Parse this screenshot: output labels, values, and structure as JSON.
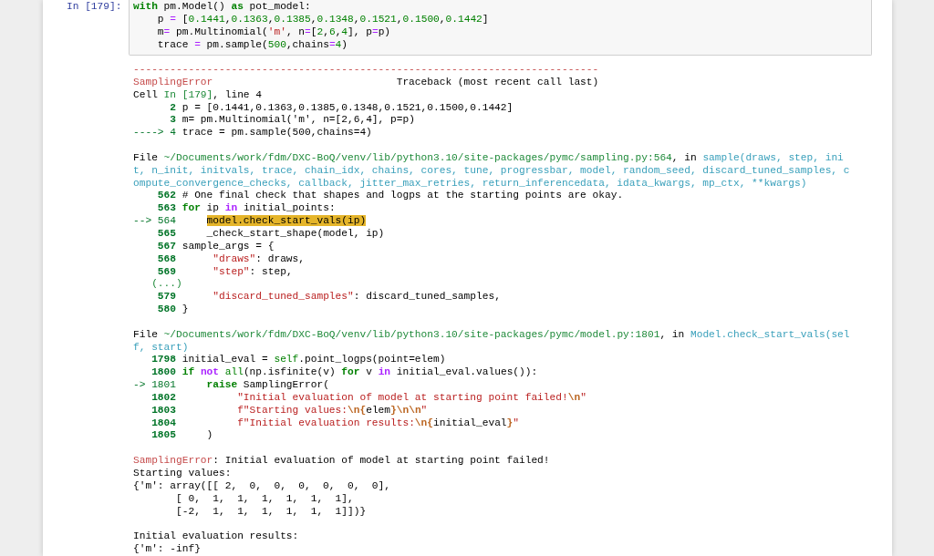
{
  "cell": {
    "prompt": "In [179]:",
    "code": [
      [
        {
          "kind": "kw",
          "text": "with"
        },
        {
          "kind": "plain",
          "text": " pm.Model() "
        },
        {
          "kind": "kw",
          "text": "as"
        },
        {
          "kind": "plain",
          "text": " pot_model:"
        }
      ],
      [
        {
          "kind": "plain",
          "text": "    p "
        },
        {
          "kind": "op",
          "text": "="
        },
        {
          "kind": "plain",
          "text": " ["
        },
        {
          "kind": "num",
          "text": "0.1441"
        },
        {
          "kind": "plain",
          "text": ","
        },
        {
          "kind": "num",
          "text": "0.1363"
        },
        {
          "kind": "plain",
          "text": ","
        },
        {
          "kind": "num",
          "text": "0.1385"
        },
        {
          "kind": "plain",
          "text": ","
        },
        {
          "kind": "num",
          "text": "0.1348"
        },
        {
          "kind": "plain",
          "text": ","
        },
        {
          "kind": "num",
          "text": "0.1521"
        },
        {
          "kind": "plain",
          "text": ","
        },
        {
          "kind": "num",
          "text": "0.1500"
        },
        {
          "kind": "plain",
          "text": ","
        },
        {
          "kind": "num",
          "text": "0.1442"
        },
        {
          "kind": "plain",
          "text": "]"
        }
      ],
      [
        {
          "kind": "plain",
          "text": "    m"
        },
        {
          "kind": "op",
          "text": "="
        },
        {
          "kind": "plain",
          "text": " pm.Multinomial("
        },
        {
          "kind": "str",
          "text": "'m'"
        },
        {
          "kind": "plain",
          "text": ", n"
        },
        {
          "kind": "op",
          "text": "="
        },
        {
          "kind": "plain",
          "text": "["
        },
        {
          "kind": "num",
          "text": "2"
        },
        {
          "kind": "plain",
          "text": ","
        },
        {
          "kind": "num",
          "text": "6"
        },
        {
          "kind": "plain",
          "text": ","
        },
        {
          "kind": "num",
          "text": "4"
        },
        {
          "kind": "plain",
          "text": "], p"
        },
        {
          "kind": "op",
          "text": "="
        },
        {
          "kind": "plain",
          "text": "p)"
        }
      ],
      [
        {
          "kind": "plain",
          "text": "    trace "
        },
        {
          "kind": "op",
          "text": "="
        },
        {
          "kind": "plain",
          "text": " pm.sample("
        },
        {
          "kind": "num",
          "text": "500"
        },
        {
          "kind": "plain",
          "text": ",chains"
        },
        {
          "kind": "op",
          "text": "="
        },
        {
          "kind": "num",
          "text": "4"
        },
        {
          "kind": "plain",
          "text": ")"
        }
      ]
    ],
    "output": [
      {
        "lines": [
          [
            {
              "kind": "rule",
              "text": "----------------------------------------------------------------------------"
            }
          ],
          [
            {
              "kind": "err",
              "text": "SamplingError"
            },
            {
              "kind": "plain",
              "text": "                              Traceback (most recent call last)"
            }
          ],
          [
            {
              "kind": "plain",
              "text": "Cell "
            },
            {
              "kind": "path",
              "text": "In [179]"
            },
            {
              "kind": "plain",
              "text": ", line 4"
            }
          ],
          [
            {
              "kind": "lno",
              "text": "      2"
            },
            {
              "kind": "plain",
              "text": " p = [0.1441,0.1363,0.1385,0.1348,0.1521,0.1500,0.1442]"
            }
          ],
          [
            {
              "kind": "lno",
              "text": "      3"
            },
            {
              "kind": "plain",
              "text": " m= pm.Multinomial('m', n=[2,6,4], p=p)"
            }
          ],
          [
            {
              "kind": "arrow",
              "text": "----> 4"
            },
            {
              "kind": "plain",
              "text": " trace = pm.sample(500,chains=4)"
            }
          ]
        ]
      },
      {
        "lines": [
          [
            {
              "kind": "plain",
              "text": "File "
            },
            {
              "kind": "path",
              "text": "~/Documents/work/fdm/DXC-BoQ/venv/lib/python3.10/site-packages/pymc/sampling.py:564"
            },
            {
              "kind": "plain",
              "text": ", in "
            },
            {
              "kind": "func",
              "text": "sample(draws, step, init, n_init, initvals, trace, chain_idx, chains, cores, tune, progressbar, model, random_seed, discard_tuned_samples, compute_convergence_checks, callback, jitter_max_retries, return_inferencedata, idata_kwargs, mp_ctx, **kwargs)"
            }
          ],
          [
            {
              "kind": "lno",
              "text": "    562"
            },
            {
              "kind": "plain",
              "text": " # One final check that shapes and logps at the starting points are okay."
            }
          ],
          [
            {
              "kind": "lno",
              "text": "    563 "
            },
            {
              "kind": "kw",
              "text": "for"
            },
            {
              "kind": "plain",
              "text": " ip "
            },
            {
              "kind": "kw2",
              "text": "in"
            },
            {
              "kind": "plain",
              "text": " initial_points:"
            }
          ],
          [
            {
              "kind": "arrow",
              "text": "--> 564     "
            },
            {
              "kind": "hl",
              "text": "model.check_start_vals(ip)"
            }
          ],
          [
            {
              "kind": "lno",
              "text": "    565"
            },
            {
              "kind": "plain",
              "text": "     _check_start_shape(model, ip)"
            }
          ],
          [
            {
              "kind": "lno",
              "text": "    567"
            },
            {
              "kind": "plain",
              "text": " sample_args = {"
            }
          ],
          [
            {
              "kind": "lno",
              "text": "    568      "
            },
            {
              "kind": "str",
              "text": "\"draws\""
            },
            {
              "kind": "plain",
              "text": ": draws,"
            }
          ],
          [
            {
              "kind": "lno",
              "text": "    569      "
            },
            {
              "kind": "str",
              "text": "\"step\""
            },
            {
              "kind": "plain",
              "text": ": step,"
            }
          ],
          [
            {
              "kind": "path",
              "text": "   (...)"
            }
          ],
          [
            {
              "kind": "lno",
              "text": "    579      "
            },
            {
              "kind": "str",
              "text": "\"discard_tuned_samples\""
            },
            {
              "kind": "plain",
              "text": ": discard_tuned_samples,"
            }
          ],
          [
            {
              "kind": "lno",
              "text": "    580"
            },
            {
              "kind": "plain",
              "text": " }"
            }
          ]
        ]
      },
      {
        "lines": [
          [
            {
              "kind": "plain",
              "text": "File "
            },
            {
              "kind": "path",
              "text": "~/Documents/work/fdm/DXC-BoQ/venv/lib/python3.10/site-packages/pymc/model.py:1801"
            },
            {
              "kind": "plain",
              "text": ", in "
            },
            {
              "kind": "func",
              "text": "Model.check_start_vals(self, start)"
            }
          ],
          [
            {
              "kind": "lno",
              "text": "   1798"
            },
            {
              "kind": "plain",
              "text": " initial_eval = "
            },
            {
              "kind": "builtin",
              "text": "self"
            },
            {
              "kind": "plain",
              "text": ".point_logps(point=elem)"
            }
          ],
          [
            {
              "kind": "lno",
              "text": "   1800 "
            },
            {
              "kind": "kw",
              "text": "if"
            },
            {
              "kind": "kw2",
              "text": " not "
            },
            {
              "kind": "builtin",
              "text": "all"
            },
            {
              "kind": "plain",
              "text": "(np.isfinite(v) "
            },
            {
              "kind": "kw",
              "text": "for"
            },
            {
              "kind": "plain",
              "text": " v "
            },
            {
              "kind": "kw2",
              "text": "in"
            },
            {
              "kind": "plain",
              "text": " initial_eval.values()):"
            }
          ],
          [
            {
              "kind": "arrow",
              "text": "-> 1801     "
            },
            {
              "kind": "kw",
              "text": "raise"
            },
            {
              "kind": "plain",
              "text": " SamplingError("
            }
          ],
          [
            {
              "kind": "lno",
              "text": "   1802          "
            },
            {
              "kind": "str",
              "text": "\"Initial evaluation of model at starting point failed!"
            },
            {
              "kind": "esc",
              "text": "\\n"
            },
            {
              "kind": "str",
              "text": "\""
            }
          ],
          [
            {
              "kind": "lno",
              "text": "   1803          "
            },
            {
              "kind": "str",
              "text": "f\"Starting values:"
            },
            {
              "kind": "esc",
              "text": "\\n"
            },
            {
              "kind": "esc",
              "text": "{"
            },
            {
              "kind": "plain",
              "text": "elem"
            },
            {
              "kind": "esc",
              "text": "}"
            },
            {
              "kind": "esc",
              "text": "\\n\\n"
            },
            {
              "kind": "str",
              "text": "\""
            }
          ],
          [
            {
              "kind": "lno",
              "text": "   1804          "
            },
            {
              "kind": "str",
              "text": "f\"Initial evaluation results:"
            },
            {
              "kind": "esc",
              "text": "\\n"
            },
            {
              "kind": "esc",
              "text": "{"
            },
            {
              "kind": "plain",
              "text": "initial_eval"
            },
            {
              "kind": "esc",
              "text": "}"
            },
            {
              "kind": "str",
              "text": "\""
            }
          ],
          [
            {
              "kind": "lno",
              "text": "   1805"
            },
            {
              "kind": "plain",
              "text": "     )"
            }
          ]
        ]
      },
      {
        "lines": [
          [
            {
              "kind": "err",
              "text": "SamplingError"
            },
            {
              "kind": "plain",
              "text": ": Initial evaluation of model at starting point failed!"
            }
          ],
          [
            {
              "kind": "plain",
              "text": "Starting values:"
            }
          ],
          [
            {
              "kind": "plain",
              "text": "{'m': array([[ 2,  0,  0,  0,  0,  0,  0],"
            }
          ],
          [
            {
              "kind": "plain",
              "text": "       [ 0,  1,  1,  1,  1,  1,  1],"
            }
          ],
          [
            {
              "kind": "plain",
              "text": "       [-2,  1,  1,  1,  1,  1,  1]])}"
            }
          ]
        ]
      },
      {
        "lines": [
          [
            {
              "kind": "plain",
              "text": "Initial evaluation results:"
            }
          ],
          [
            {
              "kind": "plain",
              "text": "{'m': -inf}"
            }
          ]
        ]
      }
    ]
  }
}
